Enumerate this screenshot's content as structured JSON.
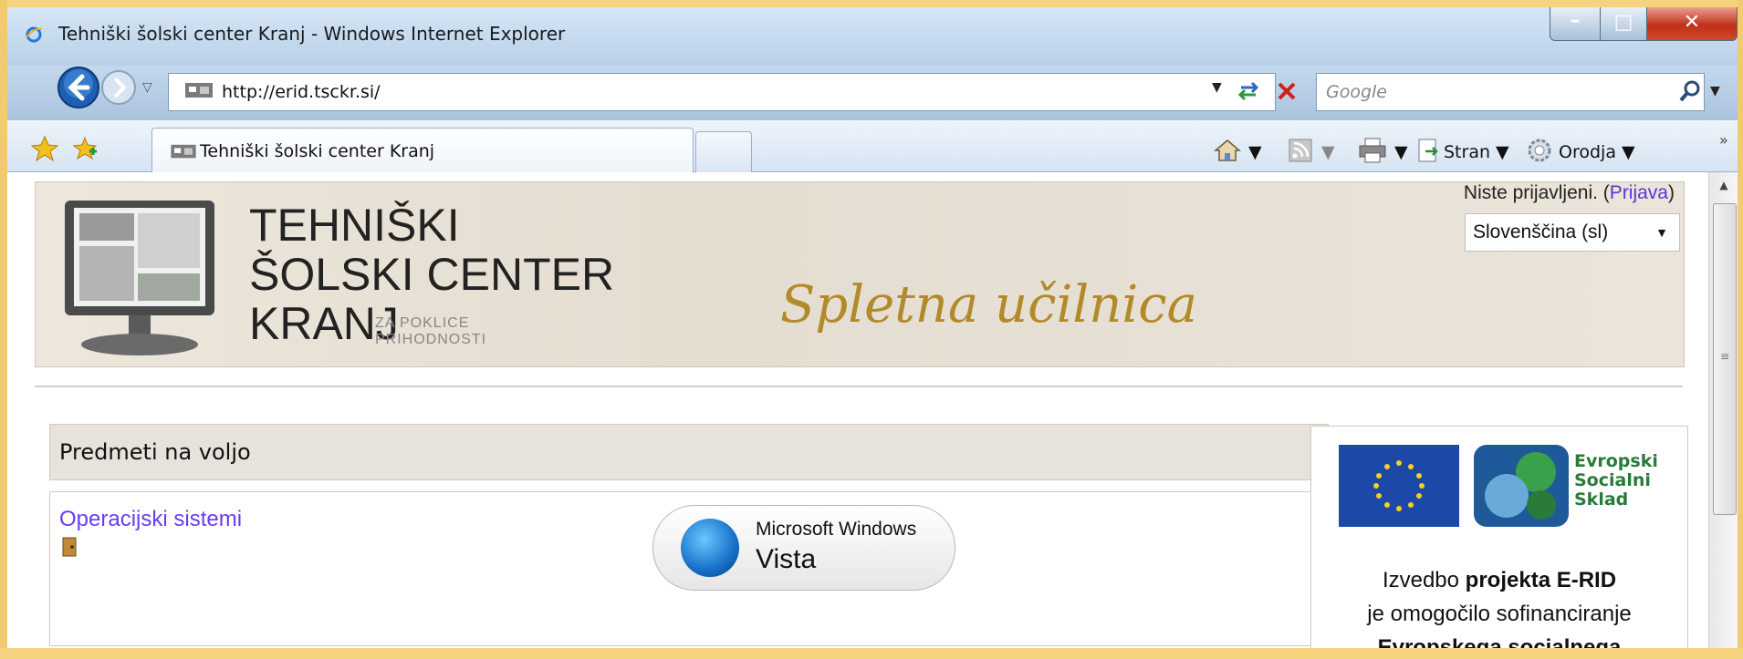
{
  "window": {
    "title": "Tehniški šolski center Kranj - Windows Internet Explorer"
  },
  "nav": {
    "url": "http://erid.tsckr.si/",
    "search_placeholder": "Google"
  },
  "tab": {
    "label": "Tehniški šolski center Kranj"
  },
  "commands": {
    "page": "Stran",
    "tools": "Orodja"
  },
  "header": {
    "logo_line1": "TEHNIŠKI",
    "logo_line2": "ŠOLSKI CENTER",
    "logo_line3": "KRANJ",
    "logo_small1": "ZA POKLICE",
    "logo_small2": "PRIHODNOSTI",
    "title": "Spletna učilnica",
    "login_prefix": "Niste prijavljeni. (",
    "login_link": "Prijava",
    "login_suffix": ")",
    "language": "Slovenščina (sl)"
  },
  "courses": {
    "heading": "Predmeti na voljo",
    "items": [
      {
        "name": "Operacijski sistemi"
      }
    ],
    "badge_line1": "Microsoft Windows",
    "badge_line2": "Vista"
  },
  "sidebar": {
    "esf_line1": "Evropski",
    "esf_line2": "Socialni",
    "esf_line3": "Sklad",
    "funding_line1_prefix": "Izvedbo ",
    "funding_line1_bold": "projekta E-RID",
    "funding_line2": "je omogočilo sofinanciranje",
    "funding_line3": "Evropskega socialnega"
  },
  "colors": {
    "link": "#6b3cf0",
    "title_gold": "#b28a2a",
    "esf_green": "#2a7a3a"
  }
}
